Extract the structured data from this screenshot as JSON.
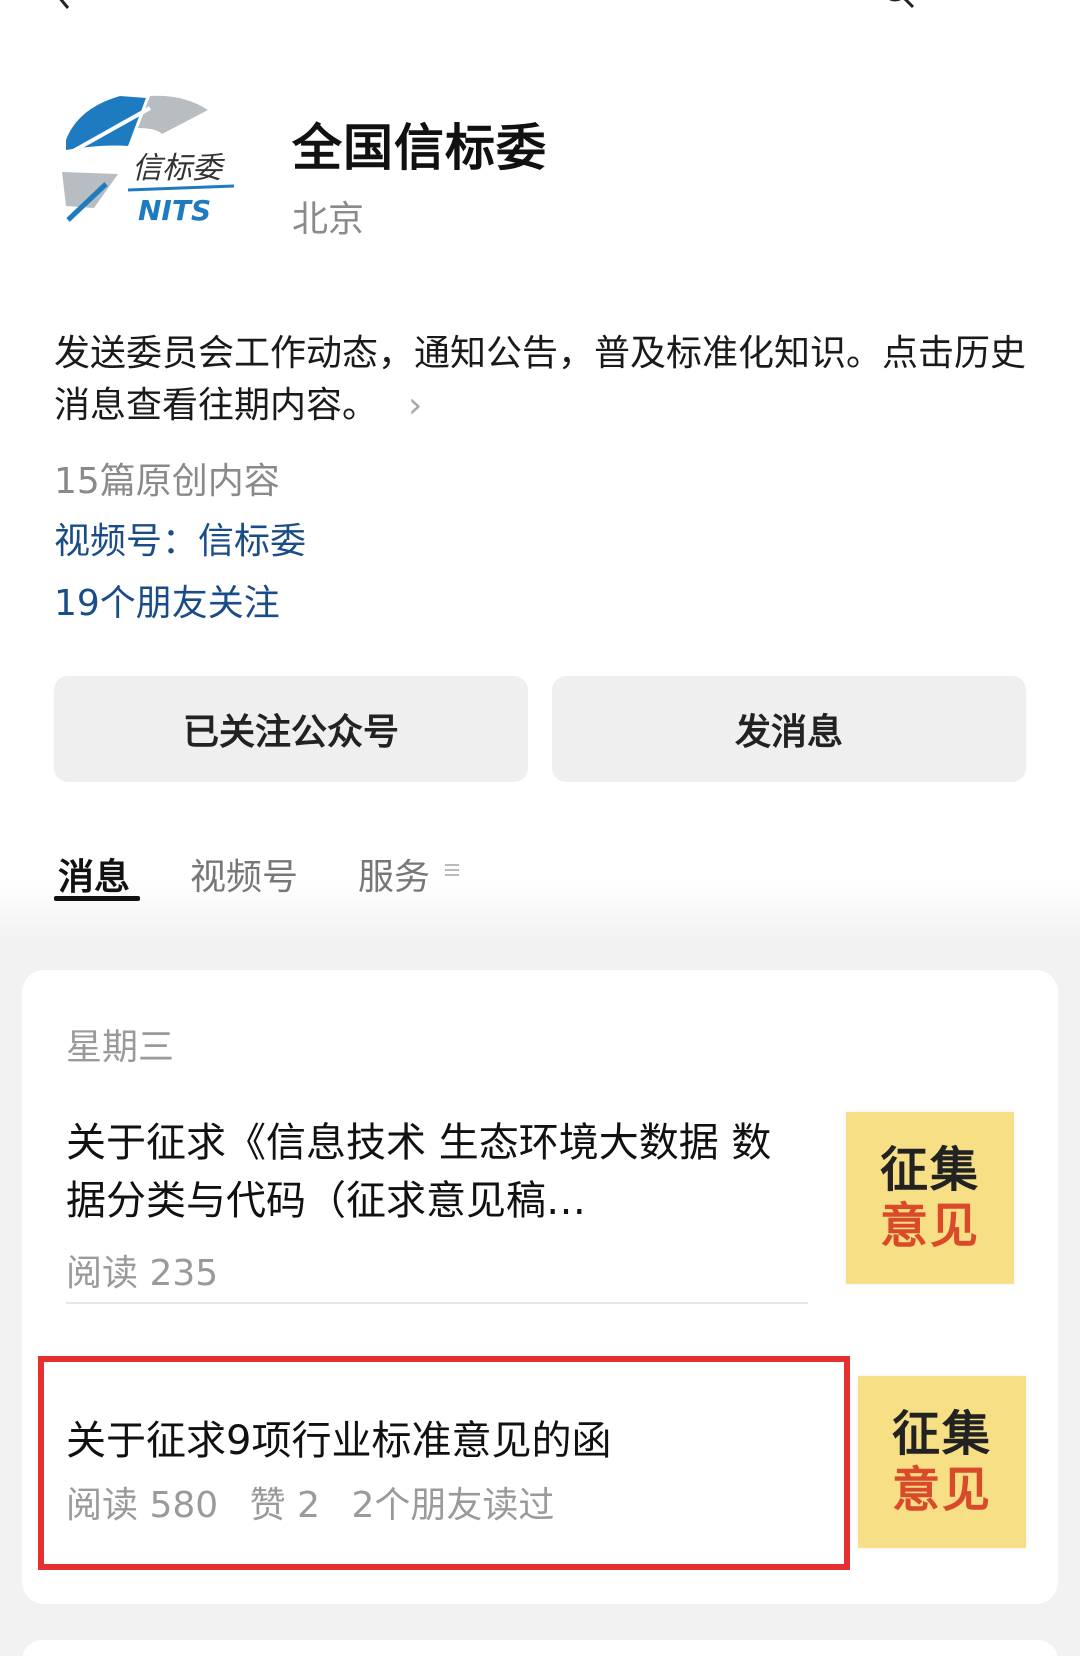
{
  "account": {
    "logo_text_cn": "信标委",
    "logo_text_en": "NITS",
    "name": "全国信标委",
    "region": "北京",
    "description": "发送委员会工作动态，通知公告，普及标准化知识。点击历史消息查看往期内容。",
    "original_count": "15篇原创内容",
    "channel": "视频号：信标委",
    "friends_following": "19个朋友关注"
  },
  "buttons": {
    "followed": "已关注公众号",
    "message": "发消息"
  },
  "tabs": [
    {
      "label": "消息",
      "active": true
    },
    {
      "label": "视频号",
      "active": false
    },
    {
      "label": "服务",
      "active": false
    }
  ],
  "feed": {
    "day": "星期三",
    "articles": [
      {
        "title": "关于征求《信息技术 生态环境大数据 数据分类与代码（征求意见稿…",
        "reads": "阅读 235",
        "thumb_line1": "征集",
        "thumb_line2": "意见"
      },
      {
        "title": "关于征求9项行业标准意见的函",
        "reads": "阅读 580",
        "likes": "赞 2",
        "friends_read": "2个朋友读过",
        "thumb_line1": "征集",
        "thumb_line2": "意见"
      }
    ]
  },
  "colors": {
    "link": "#1a4d87",
    "highlight_border": "#e63030",
    "thumb_bg": "#f7df86",
    "thumb_accent": "#d94a2a"
  },
  "icons": [
    "back-arrow-icon",
    "search-icon",
    "chevron-right-icon",
    "tab-menu-icon"
  ]
}
